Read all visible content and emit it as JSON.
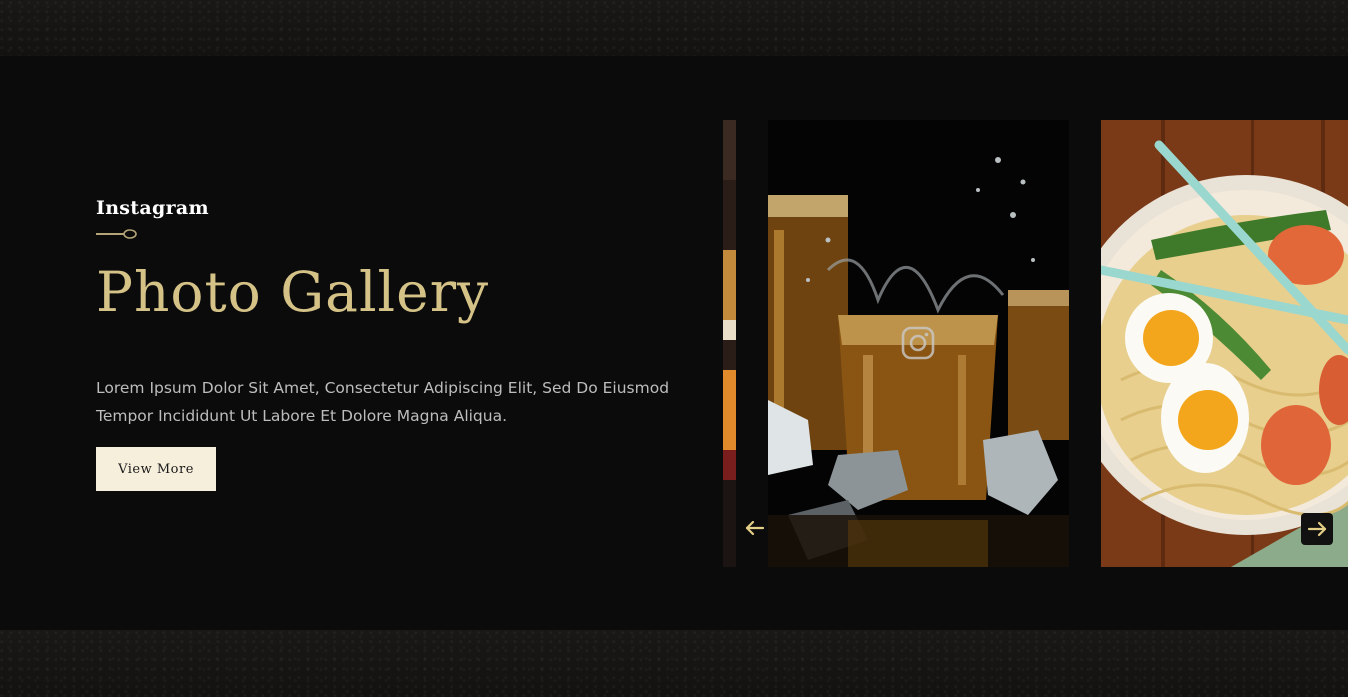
{
  "gallery": {
    "subtitle": "Instagram",
    "title": "Photo Gallery",
    "description": "Lorem Ipsum Dolor Sit Amet, Consectetur Adipiscing Elit, Sed Do Eiusmod Tempor Incididunt Ut Labore Et Dolore Magna Aliqua.",
    "button_label": "View More"
  },
  "carousel": {
    "photos": [
      {
        "subject": "partial food photo"
      },
      {
        "subject": "iced drinks splashing"
      },
      {
        "subject": "ramen bowl with eggs and shrimp"
      }
    ],
    "prev_icon": "arrow-left-icon",
    "next_icon": "arrow-right-icon",
    "overlay_icon": "instagram-icon"
  },
  "colors": {
    "accent_gold": "#d4c287",
    "button_bg": "#f6efdc",
    "section_bg": "#0b0b0b"
  }
}
